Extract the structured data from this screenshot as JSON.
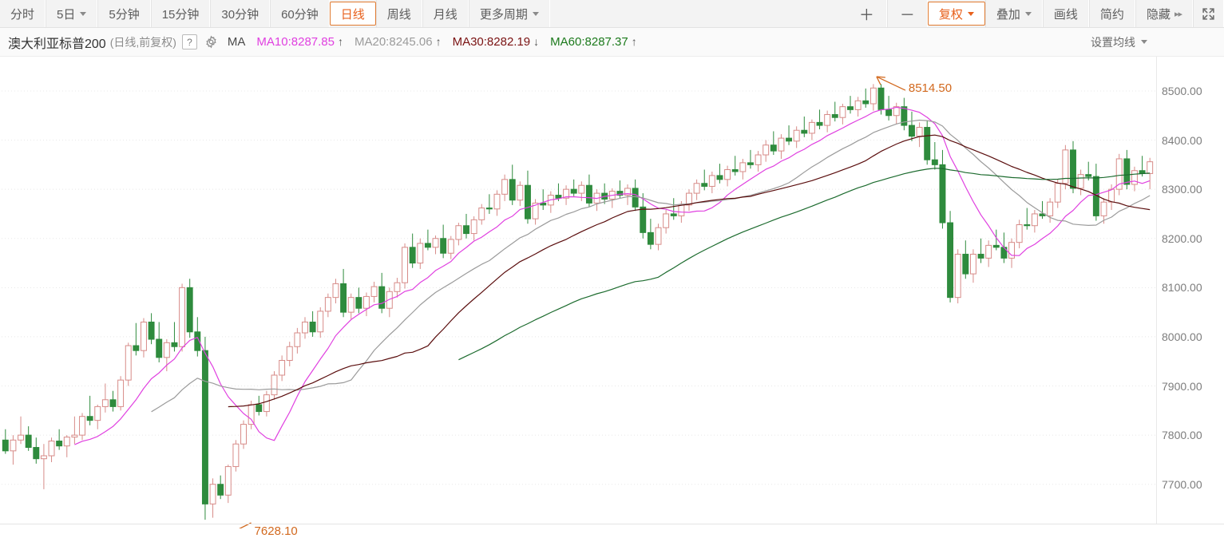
{
  "toolbar": {
    "left_items": [
      {
        "label": "分时",
        "name": "period-intraday",
        "active": false,
        "caret": false
      },
      {
        "label": "5日",
        "name": "period-5day",
        "active": false,
        "caret": true
      },
      {
        "label": "5分钟",
        "name": "period-5min",
        "active": false,
        "caret": false
      },
      {
        "label": "15分钟",
        "name": "period-15min",
        "active": false,
        "caret": false
      },
      {
        "label": "30分钟",
        "name": "period-30min",
        "active": false,
        "caret": false
      },
      {
        "label": "60分钟",
        "name": "period-60min",
        "active": false,
        "caret": false
      },
      {
        "label": "日线",
        "name": "period-daily",
        "active": true,
        "caret": false
      },
      {
        "label": "周线",
        "name": "period-weekly",
        "active": false,
        "caret": false
      },
      {
        "label": "月线",
        "name": "period-monthly",
        "active": false,
        "caret": false
      },
      {
        "label": "更多周期",
        "name": "period-more",
        "active": false,
        "caret": true
      }
    ],
    "right_items": [
      {
        "label": "＋",
        "name": "zoom-in-button",
        "active": false,
        "caret": false,
        "sym": true
      },
      {
        "label": "－",
        "name": "zoom-out-button",
        "active": false,
        "caret": false,
        "sym": true
      },
      {
        "label": "复权",
        "name": "adjust-price-button",
        "active": true,
        "caret": true
      },
      {
        "label": "叠加",
        "name": "overlay-button",
        "active": false,
        "caret": true
      },
      {
        "label": "画线",
        "name": "draw-line-button",
        "active": false,
        "caret": false
      },
      {
        "label": "简约",
        "name": "simple-mode-button",
        "active": false,
        "caret": false
      },
      {
        "label": "隐藏",
        "name": "hide-panel-button",
        "active": false,
        "caret": false,
        "dbl": "▸▸"
      }
    ],
    "fullscreen_icon": "fullscreen-icon",
    "accent_color": "#e8601c"
  },
  "infobar": {
    "instrument_name": "澳大利亚标普200",
    "instrument_sub": "(日线,前复权)",
    "help_label": "?",
    "gear_icon": "gear-icon",
    "indicator_label": "MA",
    "ma_series": [
      {
        "text": "MA10:8287.85",
        "arrow": "↑",
        "color": "#e040e0",
        "name": "ma10-readout"
      },
      {
        "text": "MA20:8245.06",
        "arrow": "↑",
        "color": "#9b9b9b",
        "name": "ma20-readout"
      },
      {
        "text": "MA30:8282.19",
        "arrow": "↓",
        "color": "#7a1212",
        "name": "ma30-readout"
      },
      {
        "text": "MA60:8287.37",
        "arrow": "↑",
        "color": "#1c7a1c",
        "name": "ma60-readout"
      }
    ],
    "settings_label": "设置均线"
  },
  "chart_data": {
    "type": "line",
    "chart_kind": "candlestick-with-moving-averages",
    "title": "澳大利亚标普200 (日线,前复权)",
    "xlabel": "",
    "ylabel": "",
    "ylim": [
      7620,
      8560
    ],
    "grid": true,
    "legend_position": "top",
    "y_ticks": [
      8500,
      8400,
      8300,
      8200,
      8100,
      8000,
      7900,
      7800,
      7700
    ],
    "y_tick_labels": [
      "8500.00",
      "8400.00",
      "8300.00",
      "8200.00",
      "8100.00",
      "8000.00",
      "7900.00",
      "7800.00",
      "7700.00"
    ],
    "annotations": [
      {
        "label": "8514.50",
        "value": 8514.5,
        "index": 113,
        "kind": "period-high",
        "color": "#d2691e",
        "name": "high-annotation"
      },
      {
        "label": "7628.10",
        "value": 7628.1,
        "index": 27,
        "kind": "period-low",
        "color": "#d2691e",
        "name": "low-annotation"
      }
    ],
    "colors": {
      "up_candle_stroke": "#d78b88",
      "up_candle_fill": "#ffffff",
      "down_candle_fill": "#2e8b3d",
      "down_candle_stroke": "#2e8b3d",
      "ma10": "#e040e0",
      "ma20": "#9b9b9b",
      "ma30": "#5a0d0d",
      "ma60": "#1c6b2e",
      "grid": "#e8e8e8",
      "background": "#ffffff"
    },
    "ma_legend": [
      {
        "name": "MA10",
        "value": 8287.85,
        "color": "#e040e0"
      },
      {
        "name": "MA20",
        "value": 8245.06,
        "color": "#9b9b9b"
      },
      {
        "name": "MA30",
        "value": 8282.19,
        "color": "#7a1212"
      },
      {
        "name": "MA60",
        "value": 8287.37,
        "color": "#1c7a1c"
      }
    ],
    "ohlc": [
      [
        7790,
        7812,
        7762,
        7768
      ],
      [
        7768,
        7800,
        7740,
        7790
      ],
      [
        7790,
        7838,
        7782,
        7800
      ],
      [
        7800,
        7818,
        7768,
        7775
      ],
      [
        7775,
        7795,
        7742,
        7752
      ],
      [
        7752,
        7782,
        7690,
        7758
      ],
      [
        7758,
        7795,
        7745,
        7788
      ],
      [
        7788,
        7812,
        7770,
        7778
      ],
      [
        7778,
        7800,
        7755,
        7796
      ],
      [
        7796,
        7838,
        7782,
        7800
      ],
      [
        7800,
        7845,
        7790,
        7838
      ],
      [
        7838,
        7880,
        7820,
        7830
      ],
      [
        7830,
        7862,
        7812,
        7858
      ],
      [
        7858,
        7905,
        7846,
        7872
      ],
      [
        7872,
        7890,
        7848,
        7858
      ],
      [
        7858,
        7920,
        7850,
        7912
      ],
      [
        7912,
        7988,
        7900,
        7982
      ],
      [
        7982,
        8028,
        7962,
        7972
      ],
      [
        7972,
        8038,
        7958,
        8030
      ],
      [
        8030,
        8048,
        7985,
        7995
      ],
      [
        7995,
        8030,
        7948,
        7958
      ],
      [
        7958,
        7995,
        7930,
        7988
      ],
      [
        7988,
        8030,
        7970,
        7980
      ],
      [
        7980,
        8108,
        7970,
        8100
      ],
      [
        8100,
        8118,
        7998,
        8010
      ],
      [
        8010,
        8040,
        7960,
        7972
      ],
      [
        7972,
        8000,
        7628,
        7660
      ],
      [
        7660,
        7712,
        7632,
        7700
      ],
      [
        7700,
        7718,
        7670,
        7678
      ],
      [
        7678,
        7740,
        7662,
        7736
      ],
      [
        7736,
        7790,
        7726,
        7782
      ],
      [
        7782,
        7830,
        7772,
        7822
      ],
      [
        7822,
        7870,
        7812,
        7862
      ],
      [
        7862,
        7880,
        7840,
        7848
      ],
      [
        7848,
        7890,
        7838,
        7882
      ],
      [
        7882,
        7930,
        7872,
        7922
      ],
      [
        7922,
        7962,
        7910,
        7952
      ],
      [
        7952,
        7990,
        7940,
        7980
      ],
      [
        7980,
        8018,
        7966,
        8008
      ],
      [
        8008,
        8040,
        7996,
        8030
      ],
      [
        8030,
        8052,
        8000,
        8010
      ],
      [
        8010,
        8060,
        7998,
        8052
      ],
      [
        8052,
        8088,
        8040,
        8080
      ],
      [
        8080,
        8118,
        8068,
        8108
      ],
      [
        8108,
        8138,
        8040,
        8050
      ],
      [
        8050,
        8088,
        8036,
        8080
      ],
      [
        8080,
        8100,
        8048,
        8058
      ],
      [
        8058,
        8090,
        8042,
        8082
      ],
      [
        8082,
        8112,
        8070,
        8102
      ],
      [
        8102,
        8130,
        8048,
        8058
      ],
      [
        8058,
        8100,
        8040,
        8092
      ],
      [
        8092,
        8120,
        8080,
        8110
      ],
      [
        8110,
        8190,
        8098,
        8182
      ],
      [
        8182,
        8210,
        8140,
        8150
      ],
      [
        8150,
        8200,
        8138,
        8190
      ],
      [
        8190,
        8218,
        8176,
        8182
      ],
      [
        8182,
        8206,
        8168,
        8200
      ],
      [
        8200,
        8228,
        8160,
        8170
      ],
      [
        8170,
        8205,
        8158,
        8198
      ],
      [
        8198,
        8232,
        8186,
        8226
      ],
      [
        8226,
        8250,
        8200,
        8210
      ],
      [
        8210,
        8245,
        8196,
        8238
      ],
      [
        8238,
        8270,
        8228,
        8262
      ],
      [
        8262,
        8290,
        8250,
        8260
      ],
      [
        8260,
        8298,
        8246,
        8290
      ],
      [
        8290,
        8330,
        8276,
        8320
      ],
      [
        8320,
        8350,
        8268,
        8278
      ],
      [
        8278,
        8316,
        8266,
        8308
      ],
      [
        8308,
        8338,
        8230,
        8240
      ],
      [
        8240,
        8280,
        8228,
        8272
      ],
      [
        8272,
        8300,
        8258,
        8268
      ],
      [
        8268,
        8296,
        8252,
        8288
      ],
      [
        8288,
        8312,
        8276,
        8282
      ],
      [
        8282,
        8308,
        8268,
        8300
      ],
      [
        8300,
        8320,
        8286,
        8292
      ],
      [
        8292,
        8316,
        8276,
        8308
      ],
      [
        8308,
        8330,
        8264,
        8272
      ],
      [
        8272,
        8300,
        8256,
        8292
      ],
      [
        8292,
        8312,
        8270,
        8280
      ],
      [
        8280,
        8302,
        8262,
        8296
      ],
      [
        8296,
        8318,
        8282,
        8288
      ],
      [
        8288,
        8310,
        8268,
        8302
      ],
      [
        8302,
        8320,
        8256,
        8264
      ],
      [
        8264,
        8292,
        8200,
        8212
      ],
      [
        8212,
        8240,
        8178,
        8188
      ],
      [
        8188,
        8230,
        8176,
        8222
      ],
      [
        8222,
        8258,
        8210,
        8250
      ],
      [
        8250,
        8282,
        8238,
        8246
      ],
      [
        8246,
        8276,
        8232,
        8268
      ],
      [
        8268,
        8300,
        8256,
        8292
      ],
      [
        8292,
        8320,
        8278,
        8312
      ],
      [
        8312,
        8340,
        8298,
        8306
      ],
      [
        8306,
        8336,
        8292,
        8328
      ],
      [
        8328,
        8352,
        8312,
        8320
      ],
      [
        8320,
        8348,
        8306,
        8340
      ],
      [
        8340,
        8368,
        8328,
        8336
      ],
      [
        8336,
        8362,
        8320,
        8354
      ],
      [
        8354,
        8380,
        8342,
        8350
      ],
      [
        8350,
        8378,
        8336,
        8370
      ],
      [
        8370,
        8400,
        8356,
        8390
      ],
      [
        8390,
        8418,
        8370,
        8378
      ],
      [
        8378,
        8412,
        8362,
        8404
      ],
      [
        8404,
        8430,
        8390,
        8398
      ],
      [
        8398,
        8428,
        8384,
        8420
      ],
      [
        8420,
        8448,
        8406,
        8414
      ],
      [
        8414,
        8442,
        8400,
        8436
      ],
      [
        8436,
        8462,
        8422,
        8430
      ],
      [
        8430,
        8460,
        8416,
        8452
      ],
      [
        8452,
        8478,
        8438,
        8446
      ],
      [
        8446,
        8474,
        8432,
        8468
      ],
      [
        8468,
        8490,
        8454,
        8462
      ],
      [
        8462,
        8488,
        8448,
        8480
      ],
      [
        8480,
        8505,
        8466,
        8474
      ],
      [
        8474,
        8514,
        8460,
        8506
      ],
      [
        8506,
        8514,
        8452,
        8462
      ],
      [
        8462,
        8490,
        8440,
        8450
      ],
      [
        8450,
        8476,
        8432,
        8468
      ],
      [
        8468,
        8486,
        8420,
        8430
      ],
      [
        8430,
        8458,
        8398,
        8408
      ],
      [
        8408,
        8436,
        8386,
        8426
      ],
      [
        8426,
        8440,
        8350,
        8360
      ],
      [
        8360,
        8396,
        8340,
        8350
      ],
      [
        8350,
        8380,
        8220,
        8232
      ],
      [
        8232,
        8256,
        8070,
        8080
      ],
      [
        8080,
        8178,
        8068,
        8168
      ],
      [
        8168,
        8196,
        8118,
        8128
      ],
      [
        8128,
        8178,
        8110,
        8168
      ],
      [
        8168,
        8200,
        8150,
        8160
      ],
      [
        8160,
        8196,
        8142,
        8186
      ],
      [
        8186,
        8218,
        8176,
        8182
      ],
      [
        8182,
        8212,
        8150,
        8160
      ],
      [
        8160,
        8200,
        8140,
        8192
      ],
      [
        8192,
        8238,
        8180,
        8228
      ],
      [
        8228,
        8262,
        8218,
        8226
      ],
      [
        8226,
        8258,
        8212,
        8250
      ],
      [
        8250,
        8276,
        8240,
        8246
      ],
      [
        8246,
        8282,
        8232,
        8274
      ],
      [
        8274,
        8320,
        8262,
        8312
      ],
      [
        8312,
        8390,
        8300,
        8380
      ],
      [
        8380,
        8398,
        8292,
        8302
      ],
      [
        8302,
        8340,
        8288,
        8330
      ],
      [
        8330,
        8356,
        8318,
        8326
      ],
      [
        8326,
        8352,
        8236,
        8246
      ],
      [
        8246,
        8282,
        8230,
        8274
      ],
      [
        8274,
        8310,
        8258,
        8300
      ],
      [
        8300,
        8372,
        8288,
        8362
      ],
      [
        8362,
        8380,
        8300,
        8310
      ],
      [
        8310,
        8346,
        8296,
        8338
      ],
      [
        8338,
        8368,
        8326,
        8332
      ],
      [
        8332,
        8364,
        8300,
        8356
      ]
    ],
    "ma_periods": [
      10,
      20,
      30,
      60
    ]
  }
}
